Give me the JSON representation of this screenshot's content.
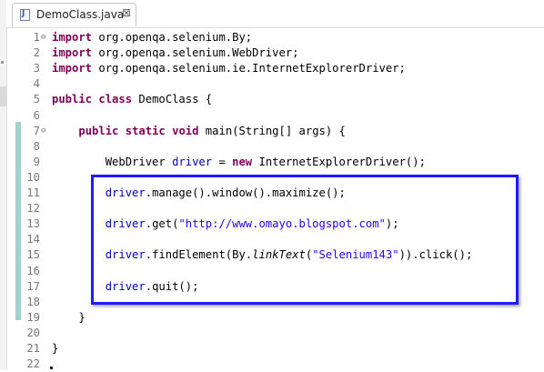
{
  "tab": {
    "title": "DemoClass.java",
    "close_glyph": "⊠"
  },
  "lines": [
    {
      "num": "1",
      "tokens": [
        [
          "kw",
          "import"
        ],
        [
          "p",
          " org.openqa.selenium.By;"
        ]
      ]
    },
    {
      "num": "2",
      "tokens": [
        [
          "kw",
          "import"
        ],
        [
          "p",
          " org.openqa.selenium.WebDriver;"
        ]
      ]
    },
    {
      "num": "3",
      "tokens": [
        [
          "kw",
          "import"
        ],
        [
          "p",
          " org.openqa.selenium.ie.InternetExplorerDriver;"
        ]
      ]
    },
    {
      "num": "4",
      "tokens": []
    },
    {
      "num": "5",
      "tokens": [
        [
          "kw",
          "public"
        ],
        [
          "p",
          " "
        ],
        [
          "kw",
          "class"
        ],
        [
          "p",
          " DemoClass {"
        ]
      ]
    },
    {
      "num": "6",
      "tokens": []
    },
    {
      "num": "7",
      "tokens": [
        [
          "p",
          "    "
        ],
        [
          "kw",
          "public"
        ],
        [
          "p",
          " "
        ],
        [
          "kw",
          "static"
        ],
        [
          "p",
          " "
        ],
        [
          "kw",
          "void"
        ],
        [
          "p",
          " main(String[] args) {"
        ]
      ]
    },
    {
      "num": "8",
      "tokens": []
    },
    {
      "num": "9",
      "tokens": [
        [
          "p",
          "        WebDriver "
        ],
        [
          "var",
          "driver"
        ],
        [
          "p",
          " = "
        ],
        [
          "kw",
          "new"
        ],
        [
          "p",
          " InternetExplorerDriver();"
        ]
      ]
    },
    {
      "num": "10",
      "tokens": []
    },
    {
      "num": "11",
      "tokens": [
        [
          "p",
          "        "
        ],
        [
          "var",
          "driver"
        ],
        [
          "p",
          ".manage().window().maximize();"
        ]
      ]
    },
    {
      "num": "12",
      "tokens": []
    },
    {
      "num": "13",
      "tokens": [
        [
          "p",
          "        "
        ],
        [
          "var",
          "driver"
        ],
        [
          "p",
          ".get("
        ],
        [
          "str",
          "\"http://www.omayo.blogspot.com\""
        ],
        [
          "p",
          ");"
        ]
      ]
    },
    {
      "num": "14",
      "tokens": []
    },
    {
      "num": "15",
      "tokens": [
        [
          "p",
          "        "
        ],
        [
          "var",
          "driver"
        ],
        [
          "p",
          ".findElement(By."
        ],
        [
          "it",
          "linkText"
        ],
        [
          "p",
          "("
        ],
        [
          "str",
          "\"Selenium143\""
        ],
        [
          "p",
          ")).click();"
        ]
      ]
    },
    {
      "num": "16",
      "tokens": []
    },
    {
      "num": "17",
      "tokens": [
        [
          "p",
          "        "
        ],
        [
          "var",
          "driver"
        ],
        [
          "p",
          ".quit();"
        ]
      ]
    },
    {
      "num": "18",
      "tokens": []
    },
    {
      "num": "19",
      "tokens": [
        [
          "p",
          "    }"
        ]
      ]
    },
    {
      "num": "20",
      "tokens": []
    },
    {
      "num": "21",
      "tokens": [
        [
          "p",
          "}"
        ]
      ]
    },
    {
      "num": "22",
      "tokens": []
    }
  ],
  "folds": {
    "1": "⊖",
    "7": "⊖"
  },
  "colors": {
    "keyword": "#7f0055",
    "field": "#0000c0",
    "string": "#2a00ff",
    "highlight_box": "#1c1cff",
    "change_band": "#a4d1cf"
  }
}
